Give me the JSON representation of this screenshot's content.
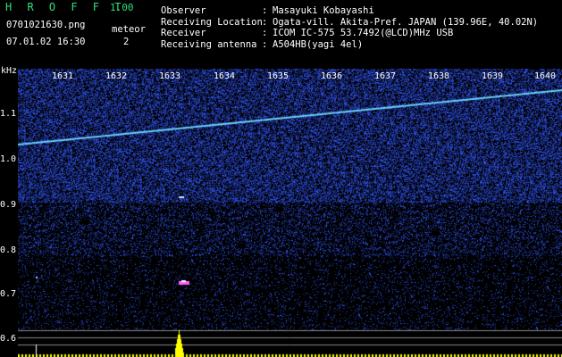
{
  "header": {
    "app_title": "H R O F F T",
    "version": "1.00",
    "file_name": "0701021630.png",
    "date_time": "07.01.02 16:30",
    "meteor_label": "meteor",
    "meteor_count": "2"
  },
  "info": [
    {
      "key": "Observer",
      "sep": ":",
      "value": "Masayuki Kobayashi"
    },
    {
      "key": "Receiving Location",
      "sep": ":",
      "value": "Ogata-vill. Akita-Pref. JAPAN (139.96E, 40.02N)"
    },
    {
      "key": "Receiver",
      "sep": ":",
      "value": "ICOM IC-575 53.7492(@LCD)MHz USB"
    },
    {
      "key": "Receiving antenna",
      "sep": ":",
      "value": "A504HB(yagi 4el)"
    }
  ],
  "axis": {
    "y_unit": "kHz",
    "y_ticks": [
      "1.1",
      "1.0",
      "0.9",
      "0.8",
      "0.7",
      "0.6"
    ],
    "x_ticks": [
      "1631",
      "1632",
      "1633",
      "1634",
      "1635",
      "1636",
      "1637",
      "1638",
      "1639",
      "1640"
    ]
  },
  "colors": {
    "background": "#000000",
    "noise": "#1a2a8a",
    "trace": "#6ad0ff",
    "meteor": "#ff60ff",
    "power": "#ffff00",
    "title": "#2fe07a"
  }
}
